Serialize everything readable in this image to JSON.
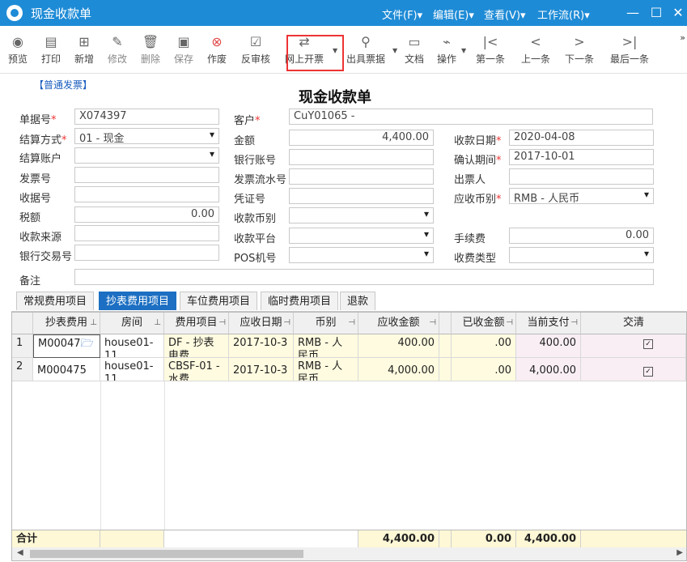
{
  "window": {
    "title": "现金收款单",
    "menus": [
      "文件(F)",
      "编辑(E)",
      "查看(V)",
      "工作流(R)"
    ],
    "min_label": "—",
    "max_label": "☐",
    "close_label": "✕"
  },
  "toolbar": {
    "preview": "预览",
    "print": "打印",
    "add": "新增",
    "edit": "修改",
    "delete": "删除",
    "save": "保存",
    "void": "作废",
    "unaudit": "反审核",
    "online_invoice": "网上开票",
    "issue_receipt": "出具票据",
    "document": "文档",
    "operation": "操作",
    "first": "第一条",
    "prev": "上一条",
    "next": "下一条",
    "last": "最后一条"
  },
  "form": {
    "invoice_type": "【普通发票】",
    "heading": "现金收款单",
    "doc_no": {
      "label": "单据号",
      "value": "X074397"
    },
    "customer": {
      "label": "客户",
      "value": "CuY01065 -"
    },
    "settle_method": {
      "label": "结算方式",
      "value": "01 - 现金"
    },
    "amount": {
      "label": "金额",
      "value": "4,400.00"
    },
    "receipt_date": {
      "label": "收款日期",
      "value": "2020-04-08"
    },
    "settle_account": {
      "label": "结算账户",
      "value": ""
    },
    "bank_account": {
      "label": "银行账号",
      "value": ""
    },
    "confirm_period": {
      "label": "确认期间",
      "value": "2017-10-01"
    },
    "invoice_no": {
      "label": "发票号",
      "value": ""
    },
    "invoice_serial": {
      "label": "发票流水号",
      "value": ""
    },
    "drawer": {
      "label": "出票人",
      "value": ""
    },
    "receipt_no": {
      "label": "收据号",
      "value": ""
    },
    "voucher_no": {
      "label": "凭证号",
      "value": ""
    },
    "ar_currency": {
      "label": "应收币别",
      "value": "RMB - 人民币"
    },
    "tax": {
      "label": "税额",
      "value": "0.00"
    },
    "receipt_currency": {
      "label": "收款币别",
      "value": ""
    },
    "source": {
      "label": "收款来源",
      "value": ""
    },
    "platform": {
      "label": "收款平台",
      "value": ""
    },
    "fee": {
      "label": "手续费",
      "value": "0.00"
    },
    "bank_trx": {
      "label": "银行交易号",
      "value": ""
    },
    "pos": {
      "label": "POS机号",
      "value": ""
    },
    "charge_type": {
      "label": "收费类型",
      "value": ""
    },
    "remark": {
      "label": "备注",
      "value": ""
    }
  },
  "tabs": [
    "常规费用项目",
    "抄表费用项目",
    "车位费用项目",
    "临时费用项目",
    "退款"
  ],
  "grid": {
    "headers": [
      "抄表费用",
      "房间",
      "费用项目",
      "应收日期",
      "币别",
      "应收金额",
      "",
      "已收金额",
      "当前支付",
      "交清"
    ],
    "rows": [
      {
        "idx": "1",
        "meter": "M00047",
        "room": "house01-\n11",
        "item": "DF - 抄表\n电费",
        "due_date": "2017-10-3",
        "currency": "RMB - 人\n民币",
        "receivable": "400.00",
        "received": ".00",
        "current": "400.00",
        "settled": true
      },
      {
        "idx": "2",
        "meter": "M000475",
        "room": "house01-\n11",
        "item": "CBSF-01 -\n水费",
        "due_date": "2017-10-3",
        "currency": "RMB - 人\n民币",
        "receivable": "4,000.00",
        "received": ".00",
        "current": "4,000.00",
        "settled": true
      }
    ],
    "total_label": "合计",
    "total_receivable": "4,400.00",
    "total_received": "0.00",
    "total_current": "4,400.00"
  }
}
